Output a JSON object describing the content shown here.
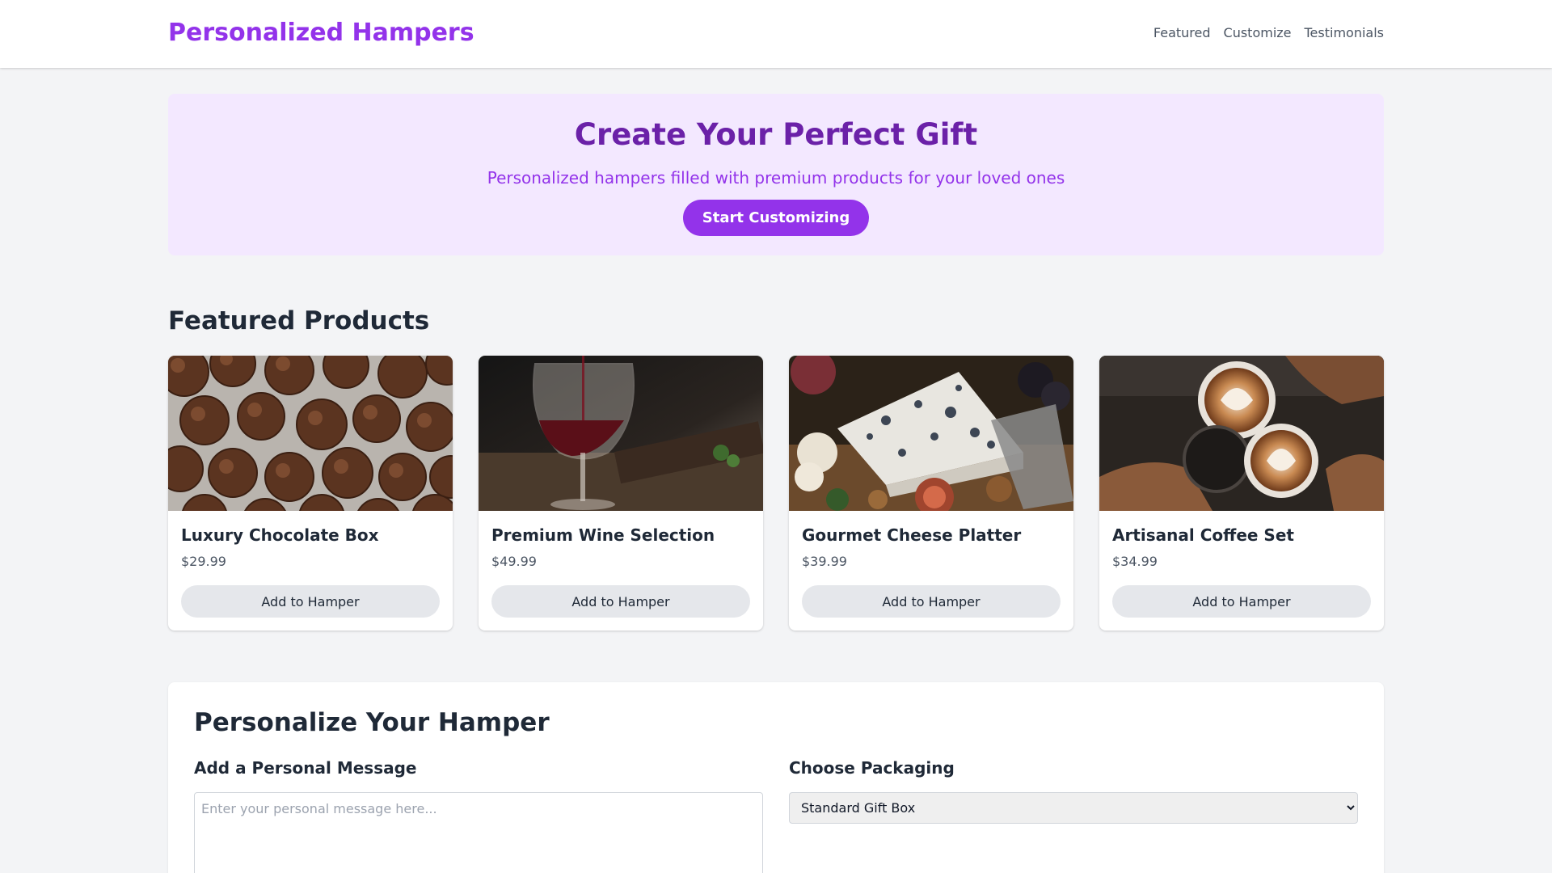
{
  "header": {
    "brand": "Personalized Hampers",
    "nav": [
      "Featured",
      "Customize",
      "Testimonials"
    ]
  },
  "hero": {
    "title": "Create Your Perfect Gift",
    "subtitle": "Personalized hampers filled with premium products for your loved ones",
    "cta": "Start Customizing"
  },
  "featured": {
    "title": "Featured Products",
    "products": [
      {
        "name": "Luxury Chocolate Box",
        "price": "$29.99",
        "button": "Add to Hamper",
        "image": "chocolate-truffles-photo"
      },
      {
        "name": "Premium Wine Selection",
        "price": "$49.99",
        "button": "Add to Hamper",
        "image": "red-wine-glass-photo"
      },
      {
        "name": "Gourmet Cheese Platter",
        "price": "$39.99",
        "button": "Add to Hamper",
        "image": "blue-cheese-platter-photo"
      },
      {
        "name": "Artisanal Coffee Set",
        "price": "$34.99",
        "button": "Add to Hamper",
        "image": "latte-art-cups-photo"
      }
    ]
  },
  "personalize": {
    "title": "Personalize Your Hamper",
    "message_label": "Add a Personal Message",
    "message_placeholder": "Enter your personal message here...",
    "packaging_label": "Choose Packaging",
    "packaging_selected": "Standard Gift Box"
  },
  "colors": {
    "brand": "#9333ea",
    "hero_bg": "#f3e8ff",
    "hero_title": "#6b21a8",
    "page_bg": "#f3f4f6"
  }
}
